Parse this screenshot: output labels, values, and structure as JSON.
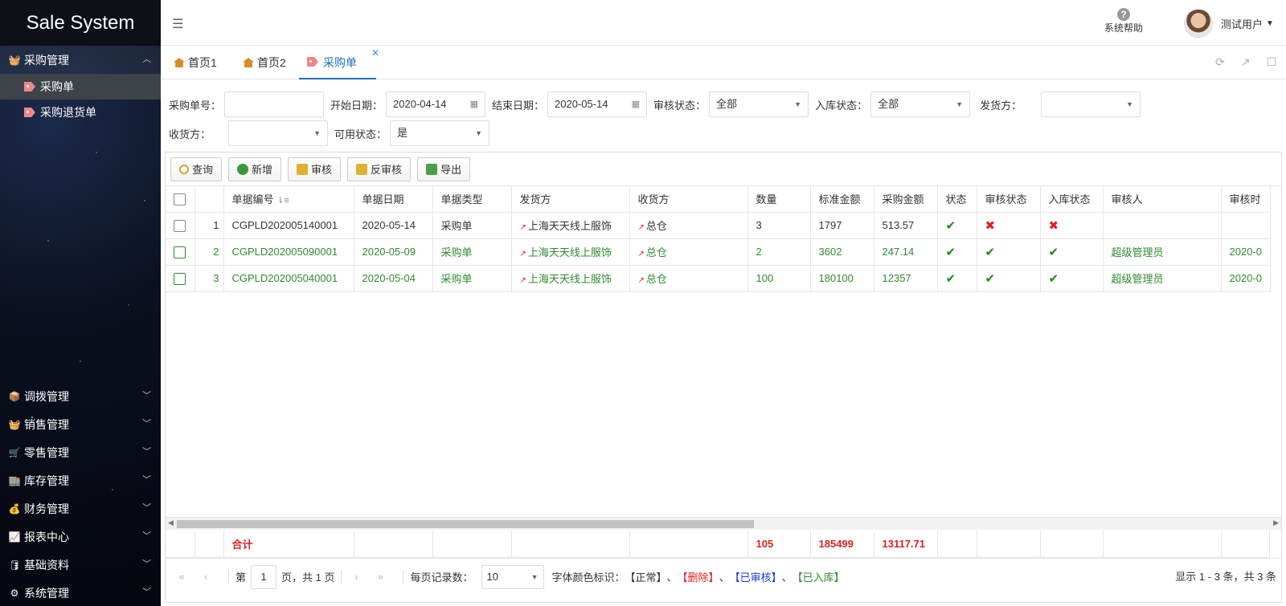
{
  "app": {
    "brand": "Sale System"
  },
  "sidebar": {
    "groups": [
      {
        "label": "采购管理",
        "items": [
          {
            "label": "采购单"
          },
          {
            "label": "采购退货单"
          }
        ]
      },
      {
        "label": "调拨管理"
      },
      {
        "label": "销售管理"
      },
      {
        "label": "零售管理"
      },
      {
        "label": "库存管理"
      },
      {
        "label": "财务管理"
      },
      {
        "label": "报表中心"
      },
      {
        "label": "基础资料"
      },
      {
        "label": "系统管理"
      }
    ]
  },
  "header": {
    "help_label": "系统帮助",
    "user_name": "测试用户"
  },
  "tabs": [
    {
      "label": "首页1"
    },
    {
      "label": "首页2"
    },
    {
      "label": "采购单"
    }
  ],
  "filters": {
    "order_no_label": "采购单号：",
    "start_date_label": "开始日期：",
    "start_date": "2020-04-14",
    "end_date_label": "结束日期：",
    "end_date": "2020-05-14",
    "audit_status_label": "审核状态：",
    "audit_status": "全部",
    "stock_status_label": "入库状态：",
    "stock_status": "全部",
    "sender_label": "发货方：",
    "receiver_label": "收货方：",
    "available_label": "可用状态：",
    "available": "是"
  },
  "toolbar": {
    "query": "查询",
    "add": "新增",
    "audit": "审核",
    "unaudit": "反审核",
    "export": "导出"
  },
  "table": {
    "columns": [
      "单据编号",
      "单据日期",
      "单据类型",
      "发货方",
      "收货方",
      "数量",
      "标准金额",
      "采购金额",
      "状态",
      "审核状态",
      "入库状态",
      "审核人",
      "审核时"
    ],
    "rows": [
      {
        "no": "1",
        "code": "CGPLD202005140001",
        "date": "2020-05-14",
        "type": "采购单",
        "sender": "上海天天线上服饰",
        "receiver": "总仓",
        "qty": "3",
        "std": "1797",
        "amt": "513.57",
        "status": "ok",
        "audit": "no",
        "stock": "no",
        "auditor": "",
        "audit_time": ""
      },
      {
        "no": "2",
        "code": "CGPLD202005090001",
        "date": "2020-05-09",
        "type": "采购单",
        "sender": "上海天天线上服饰",
        "receiver": "总仓",
        "qty": "2",
        "std": "3602",
        "amt": "247.14",
        "status": "ok",
        "audit": "ok",
        "stock": "ok",
        "auditor": "超级管理员",
        "audit_time": "2020-0"
      },
      {
        "no": "3",
        "code": "CGPLD202005040001",
        "date": "2020-05-04",
        "type": "采购单",
        "sender": "上海天天线上服饰",
        "receiver": "总仓",
        "qty": "100",
        "std": "180100",
        "amt": "12357",
        "status": "ok",
        "audit": "ok",
        "stock": "ok",
        "auditor": "超级管理员",
        "audit_time": "2020-0"
      }
    ],
    "footer": {
      "label": "合计",
      "qty": "105",
      "std": "185499",
      "amt": "13117.71"
    }
  },
  "pager": {
    "page_prefix": "第",
    "page": "1",
    "page_suffix": "页，共 1 页",
    "per_page_label": "每页记录数：",
    "per_page": "10",
    "legend_label": "字体颜色标识：",
    "legend_normal": "【正常】",
    "legend_deleted": "【删除】",
    "legend_audited": "【已审核】",
    "legend_stocked": "【已入库】",
    "sep": "、",
    "info": "显示 1 - 3 条，共 3 条"
  },
  "colors": {
    "accent": "#1d6fbd",
    "ok": "#1b8a1b",
    "error": "#e02020",
    "audited": "#1a3be0",
    "stocked": "#2e8b2e"
  }
}
